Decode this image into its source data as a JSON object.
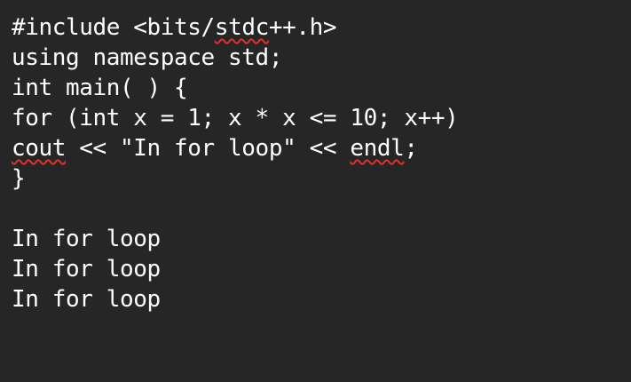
{
  "code": {
    "line1_pre": "#include <bits/",
    "line1_err": "stdc",
    "line1_post": "++.h>",
    "line2": "using namespace std;",
    "line3": "int main( ) {",
    "line4": "for (int x = 1; x * x <= 10; x++)",
    "line5_err1": "cout",
    "line5_mid": " << \"In for loop\" << ",
    "line5_err2": "endl",
    "line5_post": ";",
    "line6": "}"
  },
  "output": {
    "lines": [
      "In for loop",
      "In for loop",
      "In for loop"
    ]
  },
  "colors": {
    "background": "#262626",
    "text": "#ffffff",
    "spellcheck": "#e0312c"
  }
}
